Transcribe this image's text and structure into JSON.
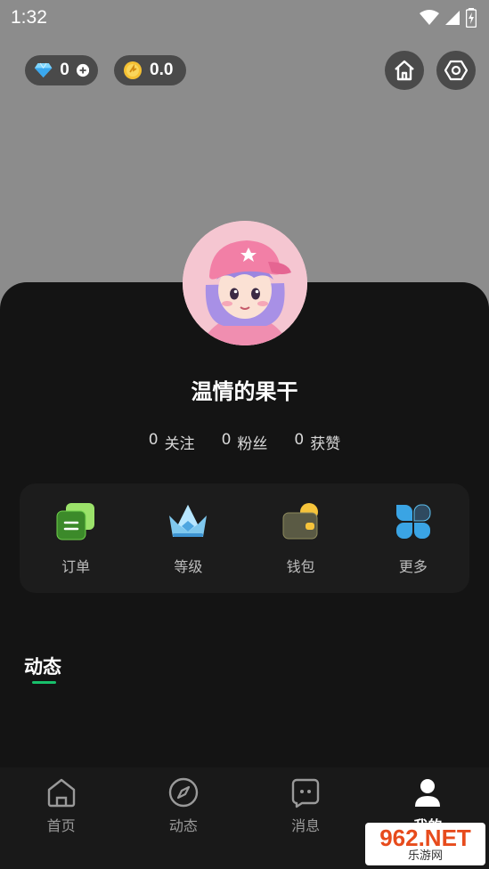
{
  "status_bar": {
    "time": "1:32"
  },
  "top_bar": {
    "diamonds": "0",
    "coins": "0.0"
  },
  "profile": {
    "username": "温情的果干",
    "stats": [
      {
        "count": "0",
        "label": "关注"
      },
      {
        "count": "0",
        "label": "粉丝"
      },
      {
        "count": "0",
        "label": "获赞"
      }
    ]
  },
  "menu": [
    {
      "label": "订单",
      "icon": "order-icon"
    },
    {
      "label": "等级",
      "icon": "crown-icon"
    },
    {
      "label": "钱包",
      "icon": "wallet-icon"
    },
    {
      "label": "更多",
      "icon": "more-icon"
    }
  ],
  "feed": {
    "title": "动态"
  },
  "bottom_nav": [
    {
      "label": "首页",
      "icon": "home-icon"
    },
    {
      "label": "动态",
      "icon": "compass-icon"
    },
    {
      "label": "消息",
      "icon": "message-icon"
    },
    {
      "label": "我的",
      "icon": "person-icon"
    }
  ],
  "watermark": {
    "main": "962.NET",
    "sub": "乐游网"
  },
  "colors": {
    "accent": "#18c06b",
    "sheet": "#141414",
    "top_bg": "#8c8c8c"
  }
}
